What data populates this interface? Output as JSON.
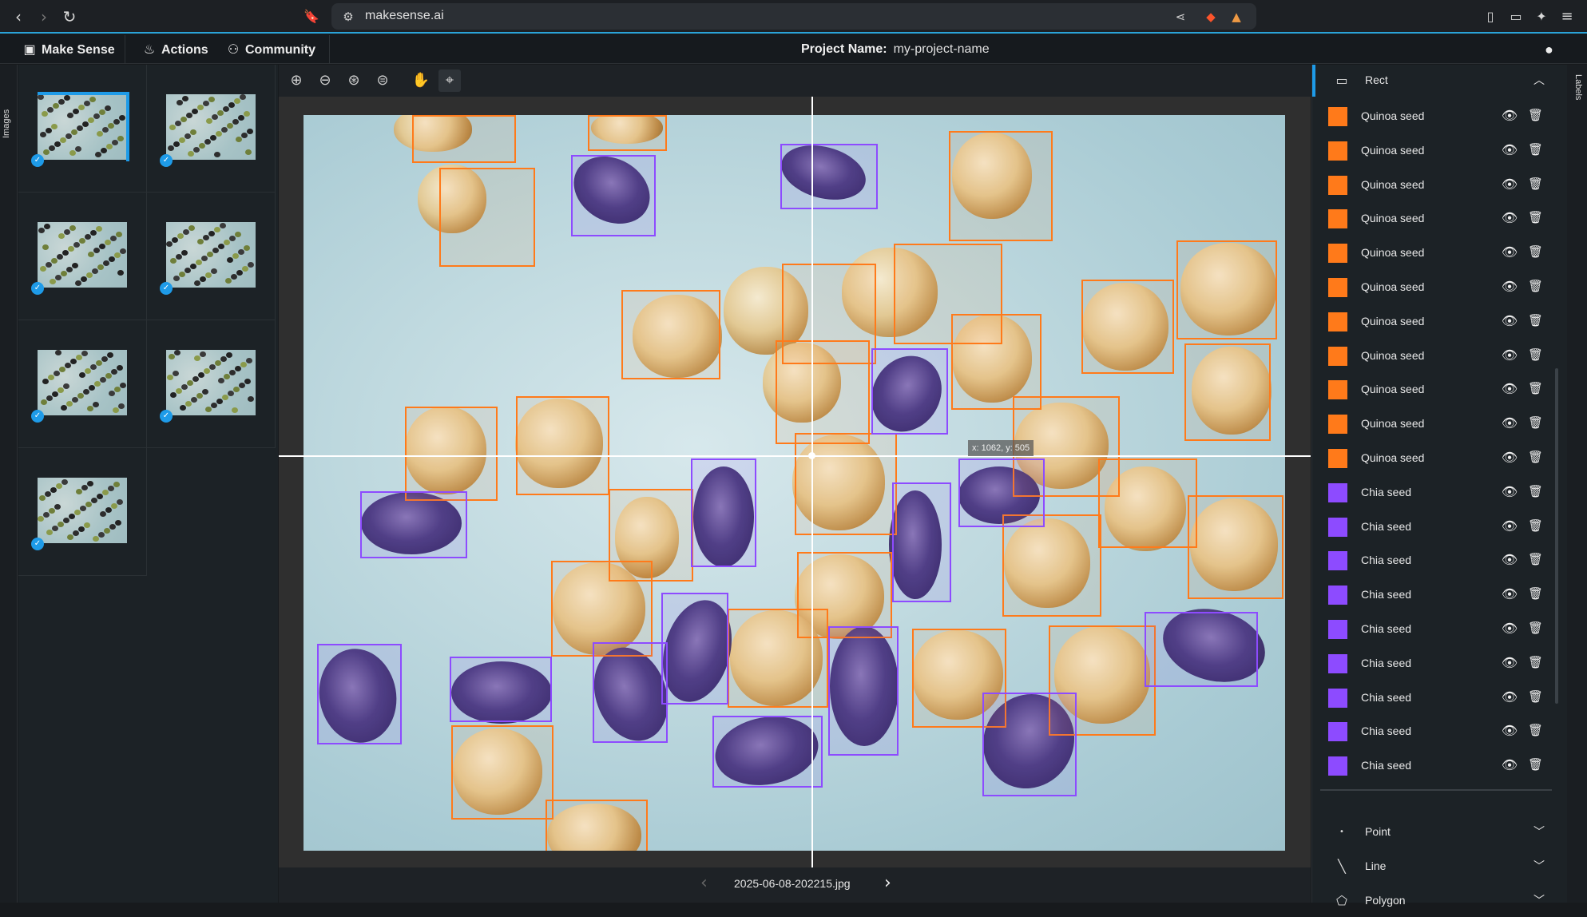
{
  "browser": {
    "url": "makesense.ai",
    "back_icon": "arrow-left",
    "forward_icon": "arrow-right",
    "reload_icon": "reload"
  },
  "app": {
    "logo_label": "Make Sense",
    "menu": [
      {
        "label": "Actions",
        "icon": "flame"
      },
      {
        "label": "Community",
        "icon": "people"
      }
    ],
    "project_label": "Project Name:",
    "project_value": "my-project-name"
  },
  "left_tab_label": "Images",
  "right_tab_label": "Labels",
  "thumbnails": [
    {
      "selected": true,
      "checked": true
    },
    {
      "selected": false,
      "checked": true
    },
    {
      "selected": false,
      "checked": true
    },
    {
      "selected": false,
      "checked": true
    },
    {
      "selected": false,
      "checked": true
    },
    {
      "selected": false,
      "checked": true
    },
    {
      "selected": false,
      "checked": true
    }
  ],
  "toolbar": [
    "zoom-in-icon",
    "zoom-out-icon",
    "zoom-fit-icon",
    "zoom-reset-icon",
    "pan-hand-icon",
    "crosshair-icon"
  ],
  "cursor_readout": "x: 1062, y: 505",
  "image_nav": {
    "filename": "2025-06-08-202215.jpg"
  },
  "label_panel": {
    "rect_section": "Rect",
    "labels": [
      {
        "name": "Quinoa seed",
        "color": "#ff7a1a"
      },
      {
        "name": "Quinoa seed",
        "color": "#ff7a1a"
      },
      {
        "name": "Quinoa seed",
        "color": "#ff7a1a"
      },
      {
        "name": "Quinoa seed",
        "color": "#ff7a1a"
      },
      {
        "name": "Quinoa seed",
        "color": "#ff7a1a"
      },
      {
        "name": "Quinoa seed",
        "color": "#ff7a1a"
      },
      {
        "name": "Quinoa seed",
        "color": "#ff7a1a"
      },
      {
        "name": "Quinoa seed",
        "color": "#ff7a1a"
      },
      {
        "name": "Quinoa seed",
        "color": "#ff7a1a"
      },
      {
        "name": "Quinoa seed",
        "color": "#ff7a1a"
      },
      {
        "name": "Quinoa seed",
        "color": "#ff7a1a"
      },
      {
        "name": "Chia seed",
        "color": "#8d4bff"
      },
      {
        "name": "Chia seed",
        "color": "#8d4bff"
      },
      {
        "name": "Chia seed",
        "color": "#8d4bff"
      },
      {
        "name": "Chia seed",
        "color": "#8d4bff"
      },
      {
        "name": "Chia seed",
        "color": "#8d4bff"
      },
      {
        "name": "Chia seed",
        "color": "#8d4bff"
      },
      {
        "name": "Chia seed",
        "color": "#8d4bff"
      },
      {
        "name": "Chia seed",
        "color": "#8d4bff"
      },
      {
        "name": "Chia seed",
        "color": "#8d4bff"
      }
    ],
    "other_sections": [
      "Point",
      "Line",
      "Polygon"
    ]
  }
}
